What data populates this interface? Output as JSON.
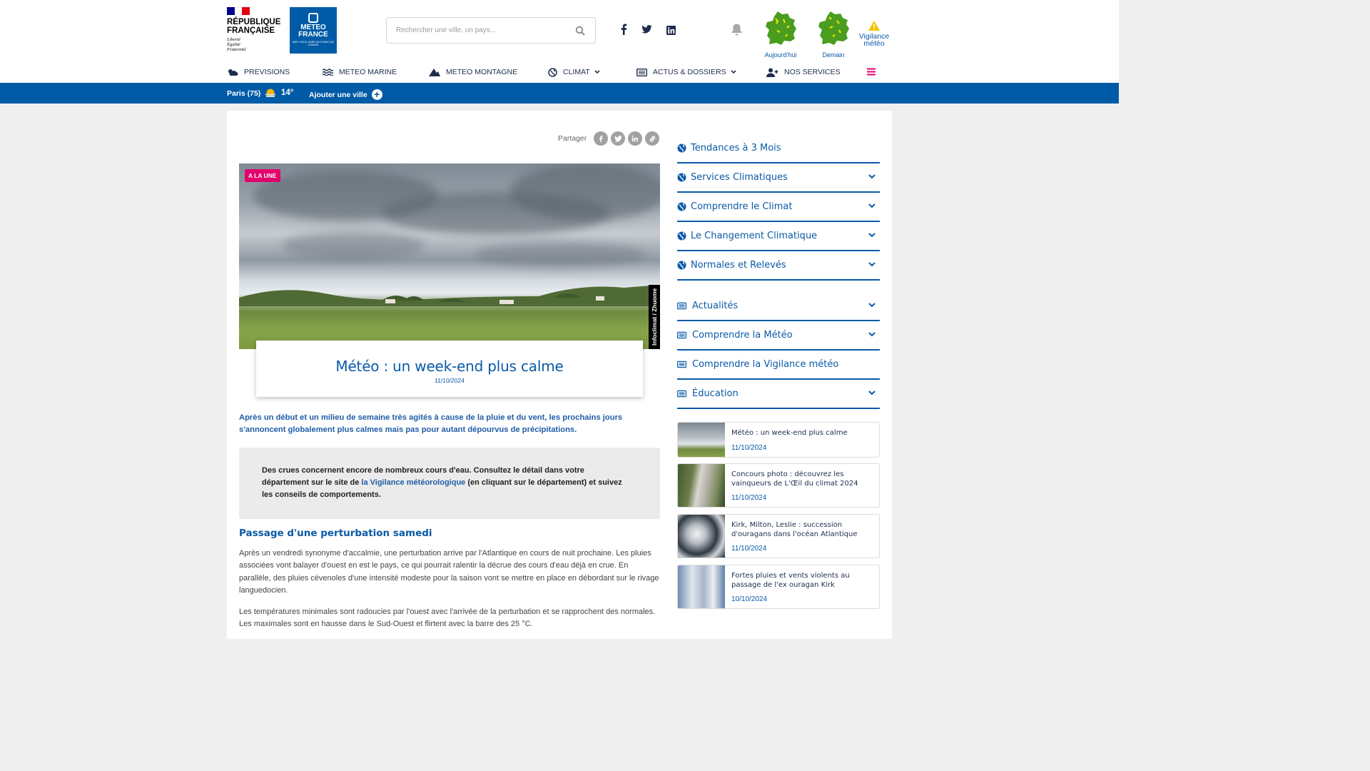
{
  "header": {
    "republique": [
      "RÉPUBLIQUE",
      "FRANÇAISE"
    ],
    "motto": [
      "Liberté",
      "Égalité",
      "Fraternité"
    ],
    "logo_name": [
      "METEO",
      "FRANCE"
    ],
    "logo_tagline": "AVEC VOUS, DANS UN CLIMAT QUI CHANGE",
    "search_placeholder": "Rechercher une ville, un pays...",
    "map_today": "Aujourd'hui",
    "map_tomorrow": "Demain",
    "vigilance": [
      "Vigilance",
      "météo"
    ]
  },
  "nav": [
    {
      "label": "PREVISIONS"
    },
    {
      "label": "METEO MARINE"
    },
    {
      "label": "METEO MONTAGNE"
    },
    {
      "label": "CLIMAT"
    },
    {
      "label": "ACTUS & DOSSIERS"
    },
    {
      "label": "NOS SERVICES"
    }
  ],
  "bluebar": {
    "city": "Paris (75)",
    "temp": "14°",
    "add_city": "Ajouter une ville"
  },
  "article": {
    "share_label": "Partager",
    "badge": "A LA UNE",
    "photo_credit": "Infoclimat / Zhuome",
    "title": "Météo : un week-end plus calme",
    "date": "11/10/2024",
    "chapo": "Après un début et un milieu de semaine très agités à cause de la pluie et du vent, les prochains jours s'annoncent globalement plus calmes mais pas pour autant dépourvus de précipitations.",
    "encart_before": "Des crues concernent encore de nombreux cours d'eau. Consultez le détail dans votre département sur le site de ",
    "encart_link": "la Vigilance météorologique",
    "encart_after": " (en cliquant sur le département) et suivez les conseils de comportements.",
    "subtitle": "Passage d'une perturbation samedi",
    "para1": "Après un vendredi synonyme d'accalmie, une perturbation arrive par l'Atlantique en cours de nuit prochaine. Les pluies associées vont balayer d'ouest en est le pays, ce qui pourrait ralentir la décrue des cours d'eau déjà en crue. En parallèle, des pluies cévenoles d'une intensité modeste pour la saison vont se mettre en place en débordant sur le rivage languedocien.",
    "para2": "Les températures minimales sont radoucies par l'ouest avec l'arrivée de la perturbation et se rapprochent des normales. Les maximales sont en hausse dans le Sud-Ouest et flirtent avec la barre des 25 °C."
  },
  "sidebar": {
    "climate_items": [
      {
        "label": "Tendances à 3 Mois"
      },
      {
        "label": "Services Climatiques"
      },
      {
        "label": "Comprendre le Climat"
      },
      {
        "label": "Le Changement Climatique"
      },
      {
        "label": "Normales et Relevés"
      }
    ],
    "news_items": [
      {
        "label": "Actualités"
      },
      {
        "label": "Comprendre la Météo"
      },
      {
        "label": "Comprendre la Vigilance météo"
      },
      {
        "label": "Éducation"
      }
    ],
    "articles": [
      {
        "title": "Météo : un week-end plus calme",
        "date": "11/10/2024"
      },
      {
        "title": "Concours photo : découvrez les vainqueurs de L'Œil du climat 2024",
        "date": "11/10/2024"
      },
      {
        "title": "Kirk, Milton, Leslie : succession d'ouragans dans l'océan Atlantique",
        "date": "11/10/2024"
      },
      {
        "title": "Fortes pluies et vents violents au passage de l'ex ouragan Kirk",
        "date": "10/10/2024"
      }
    ]
  },
  "colors": {
    "brand_blue": "#005ba7",
    "text_blue": "#0a5aa7",
    "badge_pink": "#e2006d",
    "map_green": "#4a9d1f",
    "warning_yellow": "#f3c200"
  }
}
